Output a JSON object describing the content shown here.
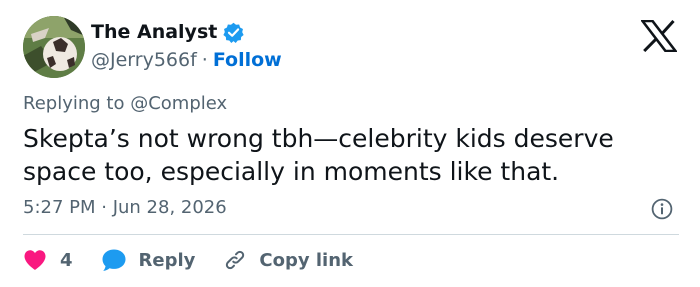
{
  "author": {
    "display_name": "The Analyst",
    "handle": "@Jerry566f",
    "separator": "·",
    "follow_label": "Follow",
    "verified_icon": "verified-badge-icon",
    "avatar_icon": "avatar-soccer-ball"
  },
  "brand": {
    "logo_icon": "x-logo-icon"
  },
  "reply_context": {
    "prefix": "Replying to",
    "mention": "@Complex"
  },
  "tweet": {
    "text": "Skepta’s not wrong tbh—celebrity kids deserve space too, especially in moments like that.",
    "timestamp": "5:27 PM · Jun 28, 2026",
    "info_icon": "info-icon"
  },
  "actions": {
    "like_count": "4",
    "like_icon": "heart-icon",
    "reply_label": "Reply",
    "reply_icon": "chat-bubble-icon",
    "copy_label": "Copy link",
    "copy_icon": "link-icon"
  },
  "colors": {
    "text_primary": "#0f1419",
    "text_secondary": "#536471",
    "follow_blue": "#006fd6",
    "verified_blue": "#1d9bf0",
    "heart_pink": "#f91880",
    "divider": "#cfd9de"
  }
}
